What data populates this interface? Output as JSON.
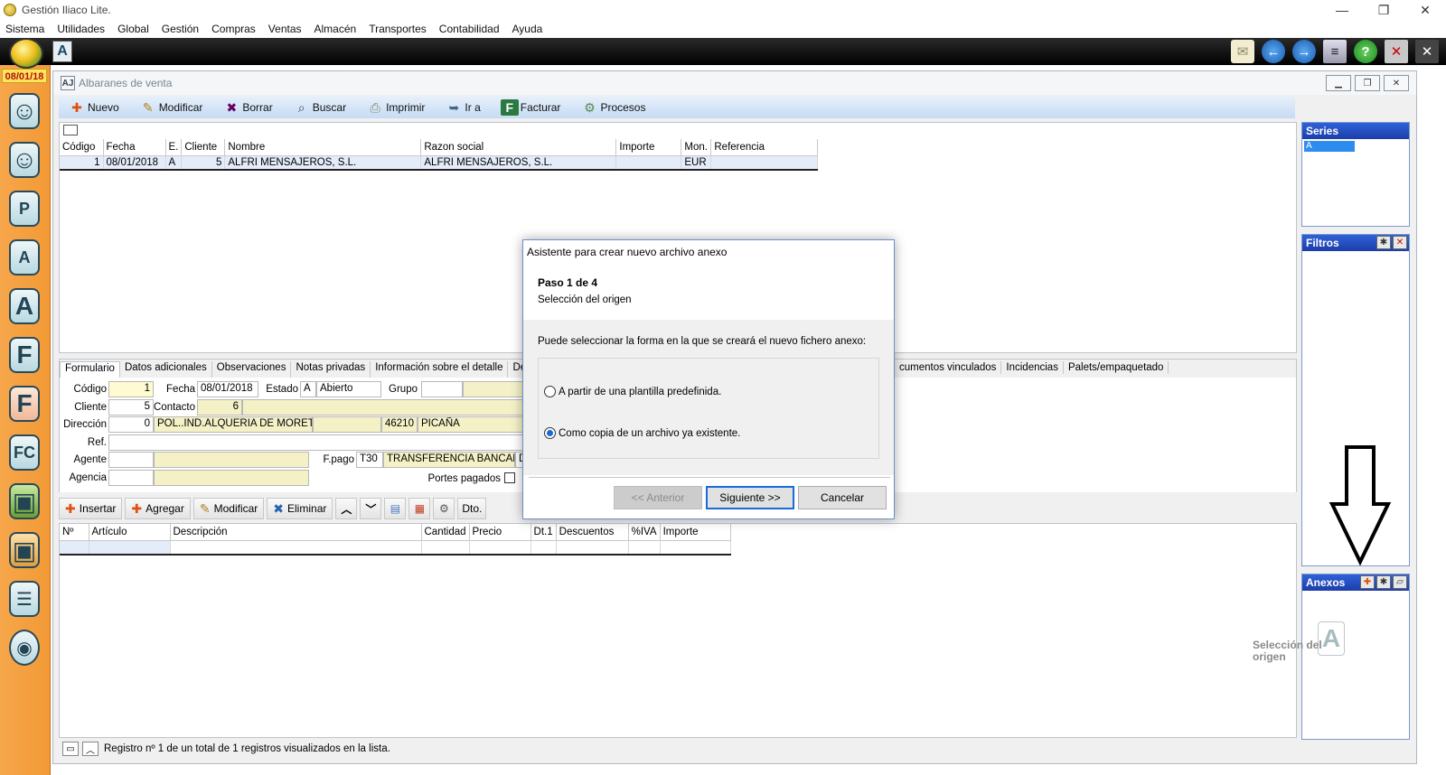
{
  "window": {
    "title": "Gestión Iliaco Lite.",
    "minimize": "—",
    "restore": "❐",
    "close": "✕"
  },
  "menu": [
    "Sistema",
    "Utilidades",
    "Global",
    "Gestión",
    "Compras",
    "Ventas",
    "Almacén",
    "Transportes",
    "Contabilidad",
    "Ayuda"
  ],
  "date_badge": "08/01/18",
  "mdi": {
    "title": "Albaranes de venta",
    "toolbar": [
      "Nuevo",
      "Modificar",
      "Borrar",
      "Buscar",
      "Imprimir",
      "Ir a",
      "Facturar",
      "Procesos"
    ]
  },
  "list": {
    "columns": [
      "Código",
      "Fecha",
      "E.",
      "Cliente",
      "Nombre",
      "Razon social",
      "Importe",
      "Mon.",
      "Referencia"
    ],
    "rows": [
      [
        "1",
        "08/01/2018",
        "A",
        "5",
        "ALFRI MENSAJEROS, S.L.",
        "ALFRI MENSAJEROS, S.L.",
        "",
        "EUR",
        ""
      ]
    ]
  },
  "form": {
    "tabs": [
      "Formulario",
      "Datos adicionales",
      "Observaciones",
      "Notas privadas",
      "Información sobre el detalle",
      "Descuento"
    ],
    "tabs_right": [
      "cumentos vinculados",
      "Incidencias",
      "Palets/empaquetado"
    ],
    "labels": {
      "codigo": "Código",
      "fecha": "Fecha",
      "estado": "Estado",
      "grupo": "Grupo",
      "cliente": "Cliente",
      "contacto": "Contacto",
      "direccion": "Dirección",
      "ref": "Ref.",
      "agente": "Agente",
      "fpago": "F.pago",
      "agencia": "Agencia",
      "portes": "Portes pagados"
    },
    "values": {
      "codigo": "1",
      "fecha": "08/01/2018",
      "estado_code": "A",
      "estado_text": "Abierto",
      "cliente": "5",
      "contacto": "6",
      "contacto_name": "",
      "direccion_num": "0",
      "direccion": "POL..IND.ALQUERIA DE MORET",
      "cp": "46210",
      "poblacion": "PICAÑA",
      "fpago_code": "T30",
      "fpago_text": "TRANSFERENCIA BANCARIA",
      "fpago_extra": "D"
    }
  },
  "detail": {
    "buttons": [
      "Insertar",
      "Agregar",
      "Modificar",
      "Eliminar"
    ],
    "dto_label": "Dto.",
    "columns": [
      "Nº",
      "Artículo",
      "Descripción",
      "Cantidad",
      "Precio",
      "Dt.1",
      "Descuentos",
      "%IVA",
      "Importe"
    ]
  },
  "status": "Registro nº 1 de un total de 1 registros visualizados en la lista.",
  "panels": {
    "series": {
      "title": "Series",
      "selected": "A"
    },
    "filtros": {
      "title": "Filtros"
    },
    "anexos": {
      "title": "Anexos"
    }
  },
  "watermark": {
    "line1": "Selección del",
    "line2": "origen",
    "logo": "A"
  },
  "dialog": {
    "title": "Asistente para crear nuevo archivo anexo",
    "step": "Paso 1 de 4",
    "subtitle": "Selección del origen",
    "description": "Puede seleccionar la forma en la que se creará el nuevo fichero anexo:",
    "option1": "A partir de una plantilla predefinida.",
    "option2": "Como copia de un archivo ya existente.",
    "selected_option": 2,
    "btn_prev": "<< Anterior",
    "btn_next": "Siguiente >>",
    "btn_cancel": "Cancelar"
  },
  "colors": {
    "sidebar": "#f29a36",
    "panel_header": "#1c3ea8",
    "accent": "#1a6ad8"
  }
}
